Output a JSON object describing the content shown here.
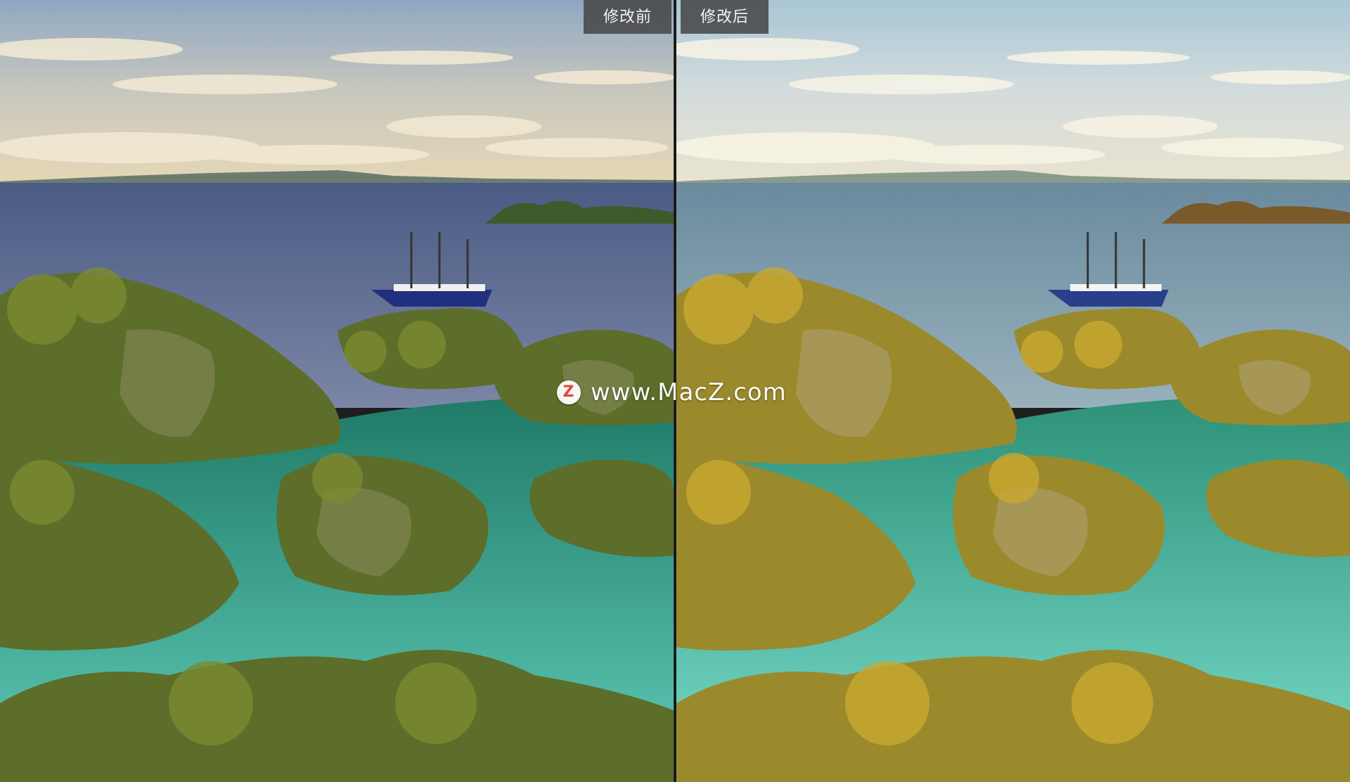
{
  "labels": {
    "before": "修改前",
    "after": "修改后"
  },
  "watermark": {
    "logo_letter": "Z",
    "text": "www.MacZ.com",
    "logo_icon": "macz-logo-icon"
  },
  "colors": {
    "label_bg": "#484848",
    "label_text": "#f2f2f2",
    "divider": "#111111",
    "watermark_logo": "#e5493a"
  }
}
